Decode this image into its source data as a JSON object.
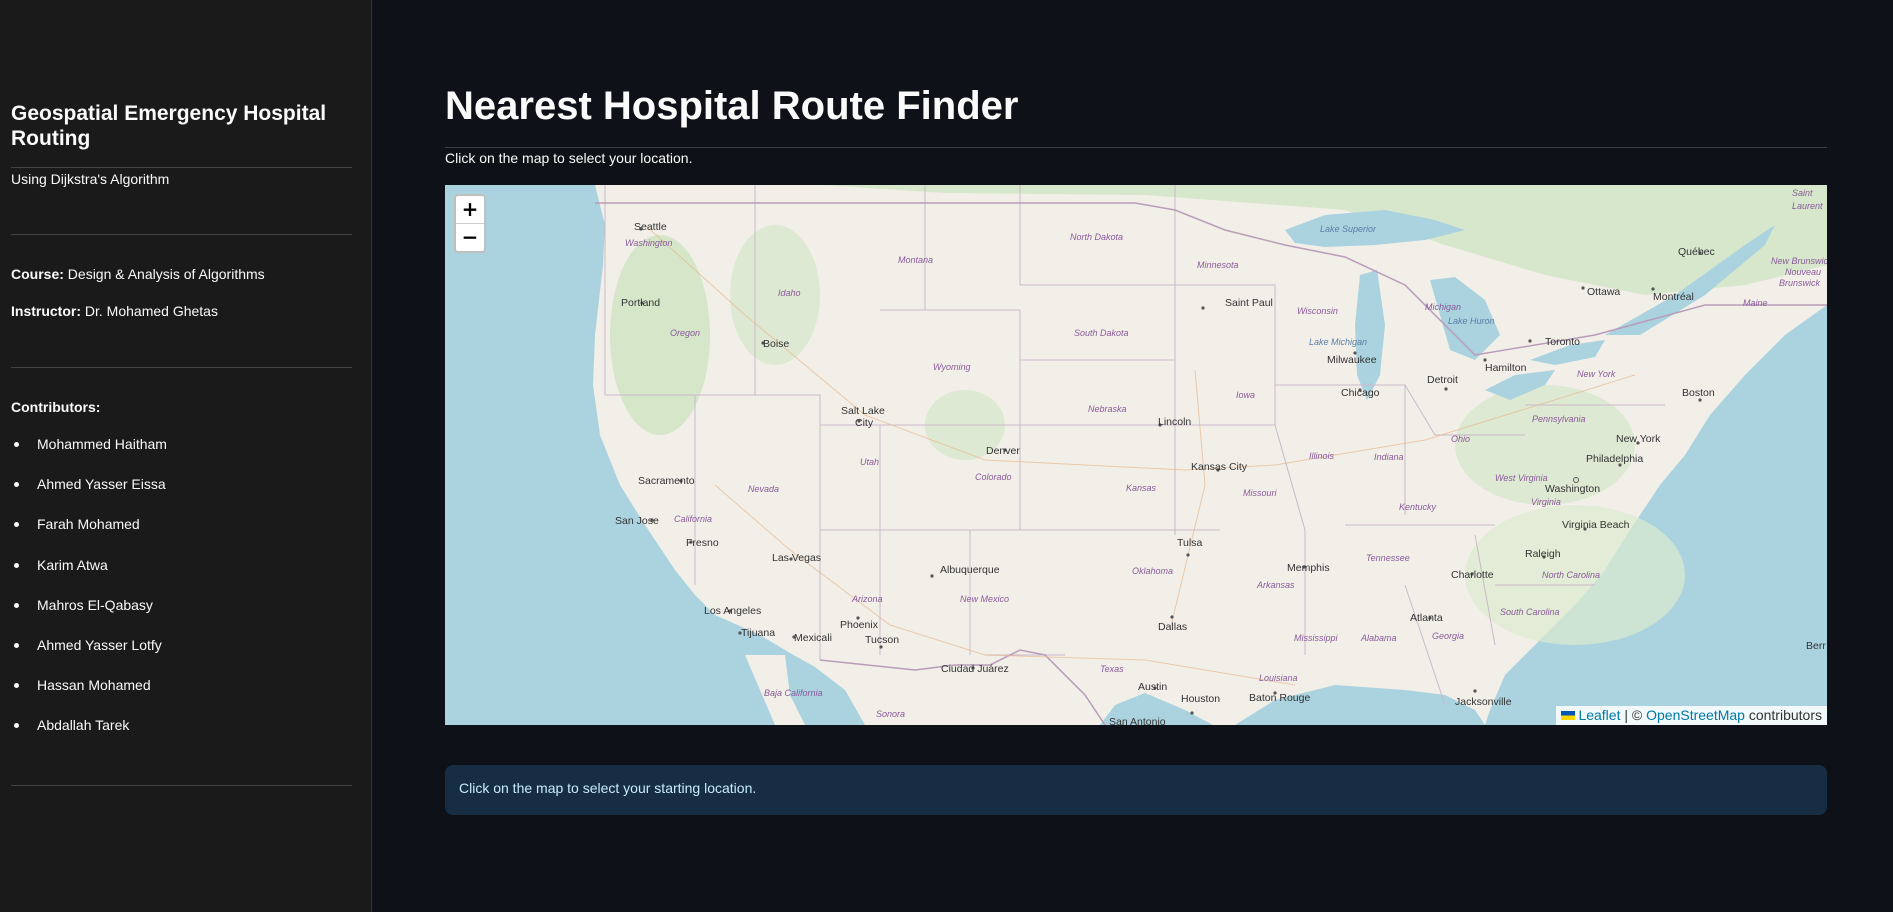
{
  "sidebar": {
    "title": "Geospatial Emergency Hospital Routing",
    "subtitle": "Using Dijkstra's Algorithm",
    "course_label": "Course:",
    "course_value": "Design & Analysis of Algorithms",
    "instructor_label": "Instructor:",
    "instructor_value": "Dr. Mohamed Ghetas",
    "contributors_label": "Contributors:",
    "contributors": [
      "Mohammed Haitham",
      "Ahmed Yasser Eissa",
      "Farah Mohamed",
      "Karim Atwa",
      "Mahros El-Qabasy",
      "Ahmed Yasser Lotfy",
      "Hassan Mohamed",
      "Abdallah Tarek"
    ]
  },
  "main": {
    "title": "Nearest Hospital Route Finder",
    "instruction": "Click on the map to select your location.",
    "info_message": "Click on the map to select your starting location."
  },
  "map": {
    "zoom_in": "+",
    "zoom_out": "−",
    "attribution": {
      "leaflet": "Leaflet",
      "separator": " | © ",
      "osm": "OpenStreetMap",
      "suffix": " contributors"
    },
    "cities": {
      "seattle": "Seattle",
      "portland": "Portland",
      "boise": "Boise",
      "sacramento": "Sacramento",
      "san_jose": "San Jose",
      "fresno": "Fresno",
      "los_angeles": "Los Angeles",
      "tijuana": "Tijuana",
      "mexicali": "Mexicali",
      "las_vegas": "Las Vegas",
      "phoenix": "Phoenix",
      "tucson": "Tucson",
      "salt_lake_1": "Salt Lake",
      "salt_lake_2": "City",
      "denver": "Denver",
      "albuquerque": "Albuquerque",
      "ciudad_juarez": "Ciudad Juárez",
      "saint_paul": "Saint Paul",
      "lincoln": "Lincoln",
      "kansas_city": "Kansas City",
      "tulsa": "Tulsa",
      "dallas": "Dallas",
      "austin": "Austin",
      "houston": "Houston",
      "san_antonio": "San Antonio",
      "baton_rouge": "Baton Rouge",
      "memphis": "Memphis",
      "atlanta": "Atlanta",
      "charlotte": "Charlotte",
      "raleigh": "Raleigh",
      "jacksonville": "Jacksonville",
      "milwaukee": "Milwaukee",
      "chicago": "Chicago",
      "detroit": "Detroit",
      "toronto": "Toronto",
      "hamilton": "Hamilton",
      "ottawa": "Ottawa",
      "montreal": "Montréal",
      "quebec": "Québec",
      "boston": "Boston",
      "new_york": "New York",
      "philadelphia": "Philadelphia",
      "washington": "Washington",
      "virginia_beach": "Virginia Beach"
    },
    "states": {
      "washington": "Washington",
      "oregon": "Oregon",
      "idaho": "Idaho",
      "montana": "Montana",
      "wyoming": "Wyoming",
      "north_dakota": "North Dakota",
      "south_dakota": "South Dakota",
      "minnesota": "Minnesota",
      "wisconsin": "Wisconsin",
      "michigan": "Michigan",
      "iowa": "Iowa",
      "nebraska": "Nebraska",
      "nevada": "Nevada",
      "utah": "Utah",
      "colorado": "Colorado",
      "kansas": "Kansas",
      "missouri": "Missouri",
      "illinois": "Illinois",
      "indiana": "Indiana",
      "ohio": "Ohio",
      "pennsylvania": "Pennsylvania",
      "new_york": "New York",
      "california": "California",
      "arizona": "Arizona",
      "new_mexico": "New Mexico",
      "oklahoma": "Oklahoma",
      "arkansas": "Arkansas",
      "tennessee": "Tennessee",
      "kentucky": "Kentucky",
      "west_virginia": "West Virginia",
      "virginia": "Virginia",
      "north_carolina": "North Carolina",
      "south_carolina": "South Carolina",
      "georgia": "Georgia",
      "alabama": "Alabama",
      "mississippi": "Mississippi",
      "louisiana": "Louisiana",
      "texas": "Texas",
      "baja_california": "Baja California",
      "sonora": "Sonora",
      "maine": "Maine",
      "new_brunswick_1": "New Brunswick",
      "new_brunswick_2": "Nouveau",
      "new_brunswick_3": "Brunswick",
      "saint_laurent_1": "Saint",
      "saint_laurent_2": "Laurent"
    },
    "water": {
      "lake_superior": "Lake Superior",
      "lake_michigan": "Lake Michigan",
      "lake_huron": "Lake Huron"
    },
    "edge_label": "Berr"
  },
  "colors": {
    "app_background": "#0e1117",
    "sidebar_background": "#1a1a1a",
    "info_background": "#172d43",
    "info_text": "#c7ebff",
    "map_water": "#aad3df",
    "map_land": "#f2efe9",
    "link": "#0078a8"
  }
}
